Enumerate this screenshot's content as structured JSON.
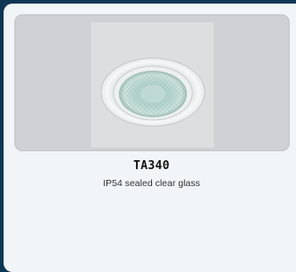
{
  "product": {
    "title": "TA340",
    "description": "IP54 sealed clear glass"
  },
  "colors": {
    "page_background": "#0f3554",
    "card_background": "#f1f5f8",
    "image_background": "#cfd1d4"
  }
}
